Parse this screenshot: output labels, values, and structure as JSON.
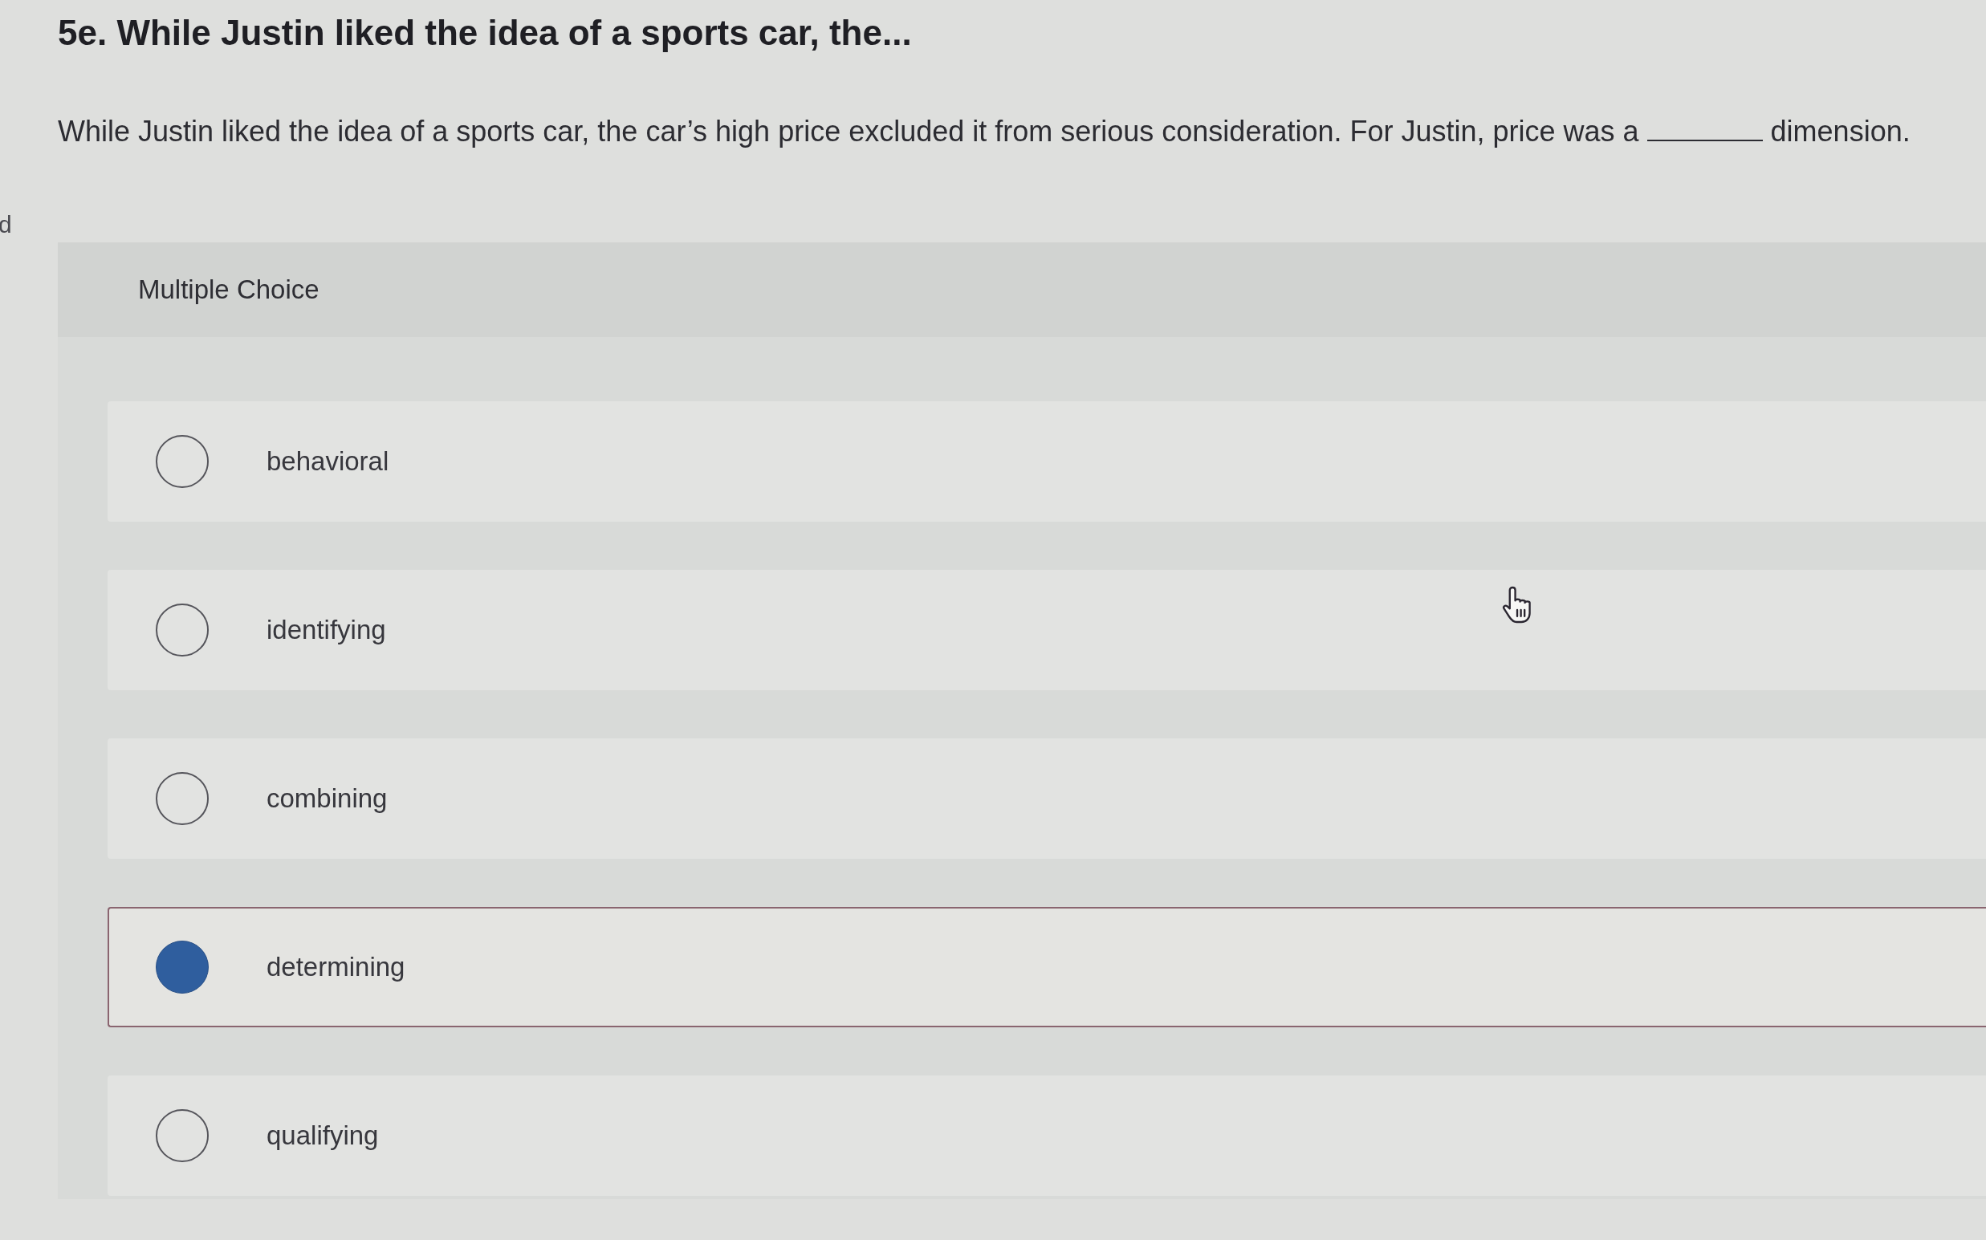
{
  "left_edge_text": "d",
  "question": {
    "title": "5e. While Justin liked the idea of a sports car, the...",
    "text_before": "While Justin liked the idea of a sports car, the car’s high price excluded it from serious consideration. For Justin, price was a",
    "text_after": "dimension."
  },
  "answer_panel": {
    "heading": "Multiple Choice",
    "options": [
      {
        "label": "behavioral",
        "selected": false
      },
      {
        "label": "identifying",
        "selected": false
      },
      {
        "label": "combining",
        "selected": false
      },
      {
        "label": "determining",
        "selected": true
      },
      {
        "label": "qualifying",
        "selected": false
      }
    ]
  }
}
